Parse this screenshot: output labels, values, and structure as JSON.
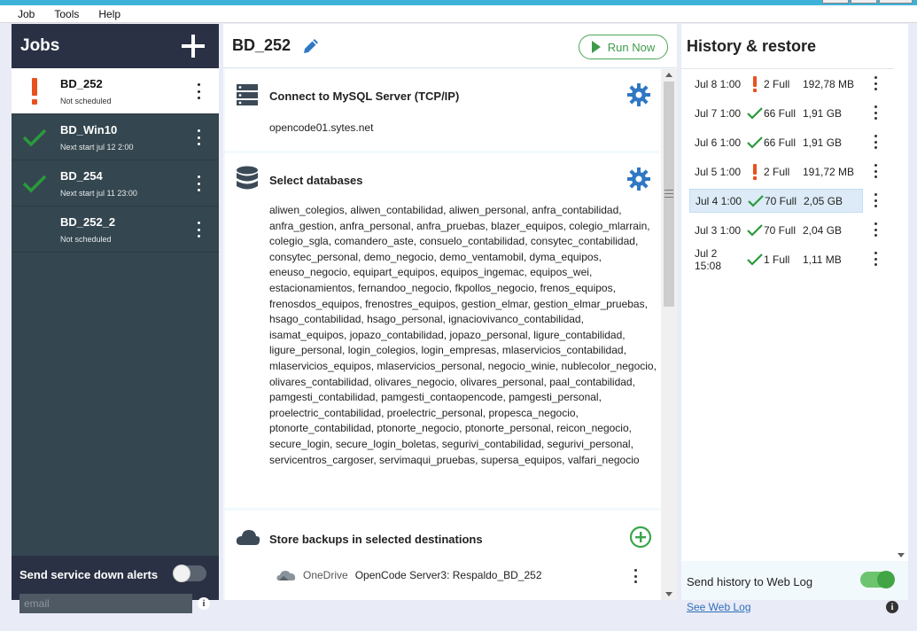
{
  "menu": [
    "Job",
    "Tools",
    "Help"
  ],
  "jobs_panel": {
    "title": "Jobs",
    "items": [
      {
        "name": "BD_252",
        "sub": "Not scheduled",
        "status": "warning",
        "selected": true
      },
      {
        "name": "BD_Win10",
        "sub": "Next start jul 12 2:00",
        "status": "ok",
        "selected": false
      },
      {
        "name": "BD_254",
        "sub": "Next start jul 11 23:00",
        "status": "ok",
        "selected": false
      },
      {
        "name": "BD_252_2",
        "sub": "Not scheduled",
        "status": "none",
        "selected": false
      }
    ],
    "alerts_label": "Send service down alerts",
    "email_placeholder": "email"
  },
  "job_detail": {
    "title": "BD_252",
    "run_label": "Run Now",
    "connect": {
      "title": "Connect to MySQL Server (TCP/IP)",
      "host": "opencode01.sytes.net"
    },
    "databases": {
      "title": "Select databases",
      "list": "aliwen_colegios, aliwen_contabilidad, aliwen_personal, anfra_contabilidad, anfra_gestion, anfra_personal, anfra_pruebas, blazer_equipos, colegio_mlarrain, colegio_sgla, comandero_aste, consuelo_contabilidad, consytec_contabilidad, consytec_personal, demo_negocio, demo_ventamobil, dyma_equipos, eneuso_negocio, equipart_equipos, equipos_ingemac, equipos_wei, estacionamientos, fernandoo_negocio, fkpollos_negocio, frenos_equipos, frenosdos_equipos, frenostres_equipos, gestion_elmar, gestion_elmar_pruebas, hsago_contabilidad, hsago_personal, ignaciovivanco_contabilidad, isamat_equipos, jopazo_contabilidad, jopazo_personal, ligure_contabilidad, ligure_personal, login_colegios, login_empresas, mlaservicios_contabilidad, mlaservicios_equipos, mlaservicios_personal, negocio_winie, nublecolor_negocio, olivares_contabilidad, olivares_negocio, olivares_personal, paal_contabilidad, pamgesti_contabilidad, pamgesti_contaopencode, pamgesti_personal, proelectric_contabilidad, proelectric_personal, propesca_negocio, ptonorte_contabilidad, ptonorte_negocio, ptonorte_personal, reicon_negocio, secure_login, secure_login_boletas, segurivi_contabilidad, segurivi_personal, servicentros_cargoser, servimaqui_pruebas, supersa_equipos, valfari_negocio"
    },
    "destinations": {
      "title": "Store backups in selected destinations",
      "provider": "OneDrive",
      "target": "OpenCode Server3: Respaldo_BD_252"
    }
  },
  "history": {
    "title": "History & restore",
    "rows": [
      {
        "date": "Jul 8 1:00",
        "status": "warning",
        "type": "2 Full",
        "size": "192,78 MB",
        "selected": false
      },
      {
        "date": "Jul 7 1:00",
        "status": "ok",
        "type": "66 Full",
        "size": "1,91 GB",
        "selected": false
      },
      {
        "date": "Jul 6 1:00",
        "status": "ok",
        "type": "66 Full",
        "size": "1,91 GB",
        "selected": false
      },
      {
        "date": "Jul 5 1:00",
        "status": "warning",
        "type": "2 Full",
        "size": "191,72 MB",
        "selected": false
      },
      {
        "date": "Jul 4 1:00",
        "status": "ok",
        "type": "70 Full",
        "size": "2,05 GB",
        "selected": true
      },
      {
        "date": "Jul 3 1:00",
        "status": "ok",
        "type": "70 Full",
        "size": "2,04 GB",
        "selected": false
      },
      {
        "date": "Jul 2 15:08",
        "status": "ok",
        "type": "1 Full",
        "size": "1,11 MB",
        "selected": false
      }
    ],
    "weblog_label": "Send history to Web Log",
    "weblog_link": "See Web Log"
  },
  "colors": {
    "accent_blue": "#2f78c4",
    "ok_green": "#2a9a3c",
    "warning_orange": "#e8511e",
    "jobs_header": "#2a3144",
    "jobs_bg": "#34464f"
  },
  "icons": {
    "add_job": "plus-icon",
    "edit": "pencil-icon",
    "run": "play-icon",
    "server": "server-icon",
    "database": "database-icon",
    "cloud": "cloud-icon",
    "settings": "gear-icon",
    "add_destination": "plus-circle-icon",
    "onedrive": "onedrive-icon",
    "info": "info-icon"
  }
}
